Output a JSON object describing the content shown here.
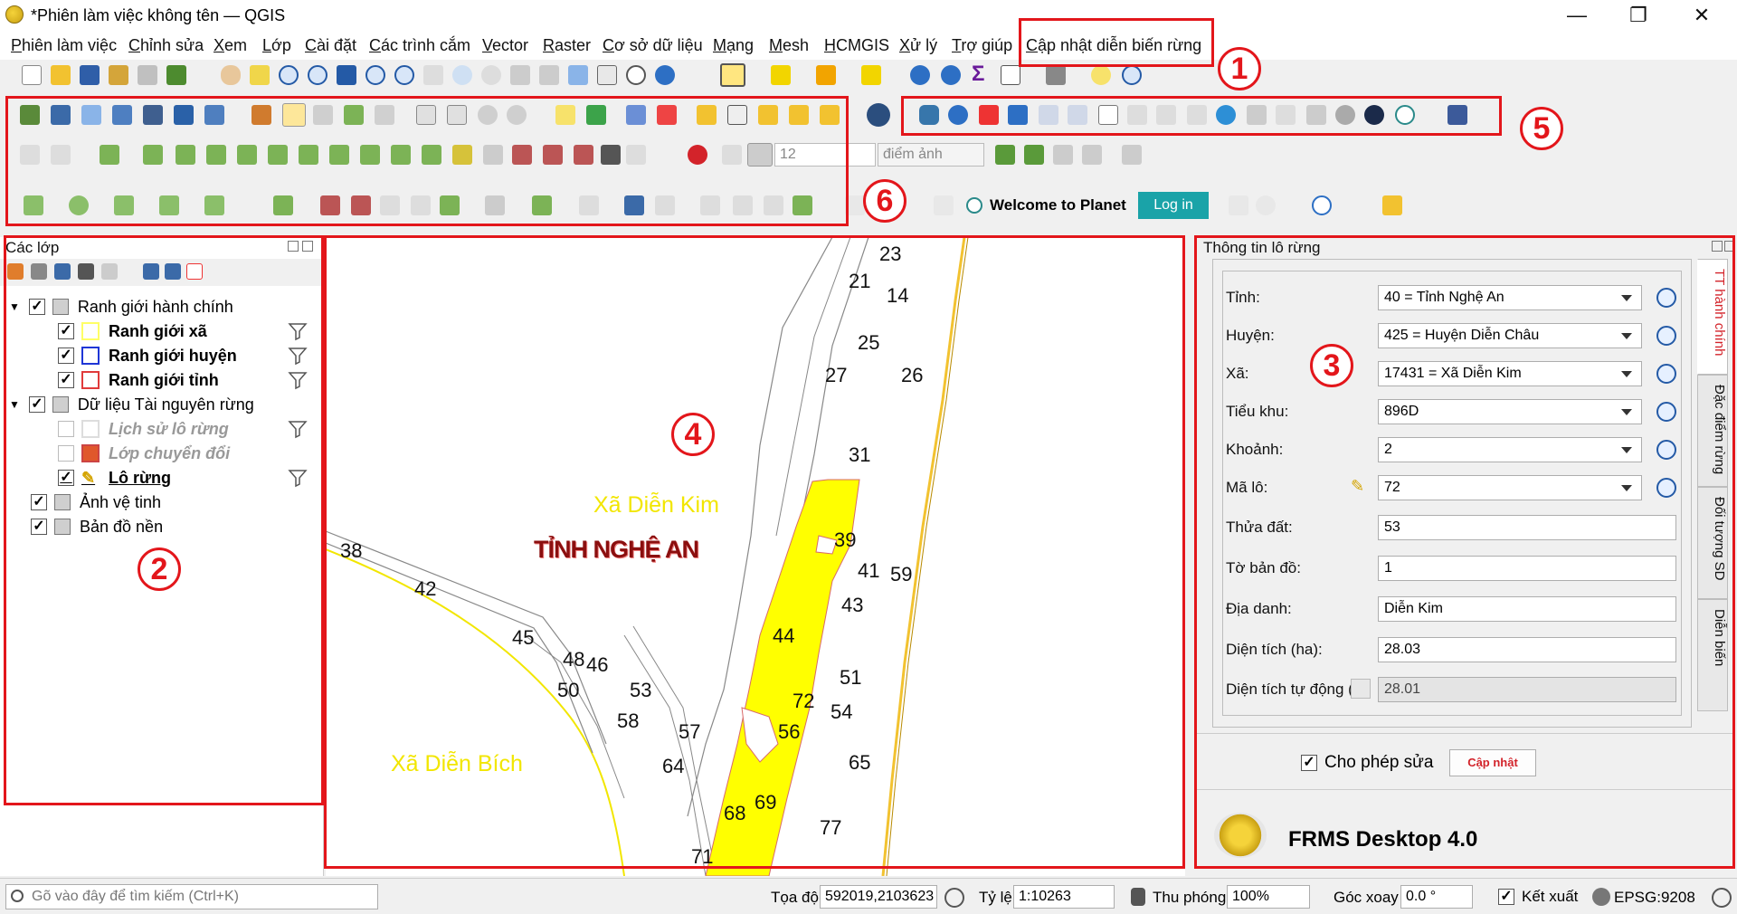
{
  "window": {
    "title": "*Phiên làm việc không tên — QGIS",
    "min": "—",
    "max": "❐",
    "close": "✕"
  },
  "menu": [
    "Phiên làm việc",
    "Chỉnh sửa",
    "Xem",
    "Lớp",
    "Cài đặt",
    "Các trình cắm",
    "Vector",
    "Raster",
    "Cơ sở dữ liệu",
    "Mạng",
    "Mesh",
    "HCMGIS",
    "Xử lý",
    "Trợ giúp",
    "Cập nhật diễn biến rừng"
  ],
  "callouts": [
    "1",
    "2",
    "3",
    "4",
    "5",
    "6"
  ],
  "toolbar": {
    "snap_value": "12",
    "snap_unit": "điểm ảnh",
    "planet_welcome": "Welcome to Planet",
    "planet_login": "Log in"
  },
  "layers": {
    "title": "Các lớp",
    "items": [
      {
        "label": "Ranh giới hành chính",
        "checked": true,
        "level": 0,
        "group": true
      },
      {
        "label": "Ranh giới xã",
        "checked": true,
        "level": 1,
        "color": "#ffff66"
      },
      {
        "label": "Ranh giới huyện",
        "checked": true,
        "level": 1,
        "color": "#1f36d6"
      },
      {
        "label": "Ranh giới tỉnh",
        "checked": true,
        "level": 1,
        "color": "#e03a3a"
      },
      {
        "label": "Dữ liệu Tài nguyên rừng",
        "checked": true,
        "level": 0,
        "group": true
      },
      {
        "label": "Lịch sử lô rừng",
        "checked": false,
        "level": 1,
        "color": "#ffffff"
      },
      {
        "label": "Lớp chuyển đổi",
        "checked": false,
        "level": 1,
        "color": "#e0582c"
      },
      {
        "label": "Lô rừng",
        "checked": true,
        "level": 1,
        "color": "#f2d500"
      },
      {
        "label": "Ảnh vệ tinh",
        "checked": true,
        "level": 0
      },
      {
        "label": "Bản đồ nền",
        "checked": true,
        "level": 0
      }
    ]
  },
  "map": {
    "xa_dien_kim": "Xã Diễn Kim",
    "xa_dien_bich": "Xã Diễn Bích",
    "tinh": "TỈNH NGHỆ AN",
    "parcels": [
      "23",
      "21",
      "14",
      "25",
      "27",
      "26",
      "31",
      "39",
      "41",
      "59",
      "43",
      "44",
      "51",
      "72",
      "54",
      "56",
      "65",
      "69",
      "68",
      "77",
      "71",
      "38",
      "42",
      "45",
      "48",
      "46",
      "53",
      "50",
      "58",
      "57",
      "64"
    ]
  },
  "info_panel": {
    "title": "Thông tin lô rừng",
    "fields": {
      "tinh_label": "Tỉnh:",
      "tinh_value": "40 = Tỉnh Nghệ An",
      "huyen_label": "Huyện:",
      "huyen_value": "425 = Huyện Diễn Châu",
      "xa_label": "Xã:",
      "xa_value": "17431 = Xã Diễn Kim",
      "tieukhu_label": "Tiểu khu:",
      "tieukhu_value": "896D",
      "khoanh_label": "Khoảnh:",
      "khoanh_value": "2",
      "malo_label": "Mã lô:",
      "malo_value": "72",
      "thuadat_label": "Thửa đất:",
      "thuadat_value": "53",
      "tobando_label": "Tờ bản đồ:",
      "tobando_value": "1",
      "diadanh_label": "Địa danh:",
      "diadanh_value": "Diễn Kim",
      "dientich_label": "Diện tích (ha):",
      "dientich_value": "28.03",
      "dttudong_label": "Diện tích tự động (",
      "dttudong_value": "28.01"
    },
    "tabs": [
      "TT hành chính",
      "Đặc điểm rừng",
      "Đối tượng SD",
      "Diễn biến"
    ],
    "allow_edit": "Cho phép sửa",
    "update_btn": "Cập nhật",
    "app_name": "FRMS Desktop 4.0"
  },
  "status": {
    "search_placeholder": "Gõ vào đây để tìm kiếm (Ctrl+K)",
    "coord_label": "Tọa độ",
    "coord_value": "592019,2103623",
    "scale_label": "Tỷ lệ",
    "scale_value": "1:10263",
    "zoom_label": "Thu phóng",
    "zoom_value": "100%",
    "rotate_label": "Góc xoay",
    "rotate_value": "0.0 °",
    "render_label": "Kết xuất",
    "crs": "EPSG:9208"
  }
}
